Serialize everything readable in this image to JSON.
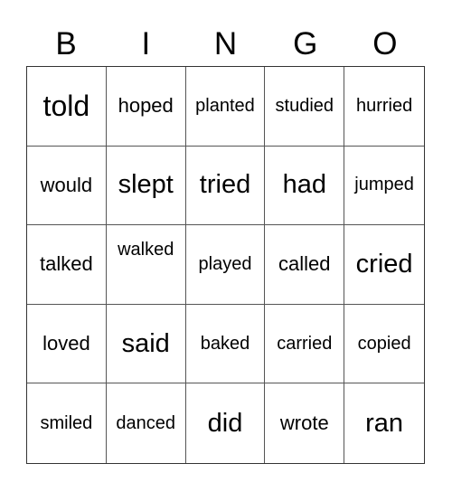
{
  "card": {
    "header_letters": [
      "B",
      "I",
      "N",
      "G",
      "O"
    ],
    "rows": [
      [
        {
          "word": "told",
          "size": "xl"
        },
        {
          "word": "hoped",
          "size": "s"
        },
        {
          "word": "planted",
          "size": "xs"
        },
        {
          "word": "studied",
          "size": "xs"
        },
        {
          "word": "hurried",
          "size": "xs"
        }
      ],
      [
        {
          "word": "would",
          "size": "s"
        },
        {
          "word": "slept",
          "size": "l"
        },
        {
          "word": "tried",
          "size": "l"
        },
        {
          "word": "had",
          "size": "l"
        },
        {
          "word": "jumped",
          "size": "xs"
        }
      ],
      [
        {
          "word": "talked",
          "size": "s"
        },
        {
          "word": "walked",
          "size": "xs",
          "align": "top"
        },
        {
          "word": "played",
          "size": "xs"
        },
        {
          "word": "called",
          "size": "s"
        },
        {
          "word": "cried",
          "size": "l"
        }
      ],
      [
        {
          "word": "loved",
          "size": "s"
        },
        {
          "word": "said",
          "size": "l"
        },
        {
          "word": "baked",
          "size": "xs"
        },
        {
          "word": "carried",
          "size": "xs"
        },
        {
          "word": "copied",
          "size": "xs"
        }
      ],
      [
        {
          "word": "smiled",
          "size": "xs"
        },
        {
          "word": "danced",
          "size": "xs"
        },
        {
          "word": "did",
          "size": "l"
        },
        {
          "word": "wrote",
          "size": "s"
        },
        {
          "word": "ran",
          "size": "l"
        }
      ]
    ]
  }
}
